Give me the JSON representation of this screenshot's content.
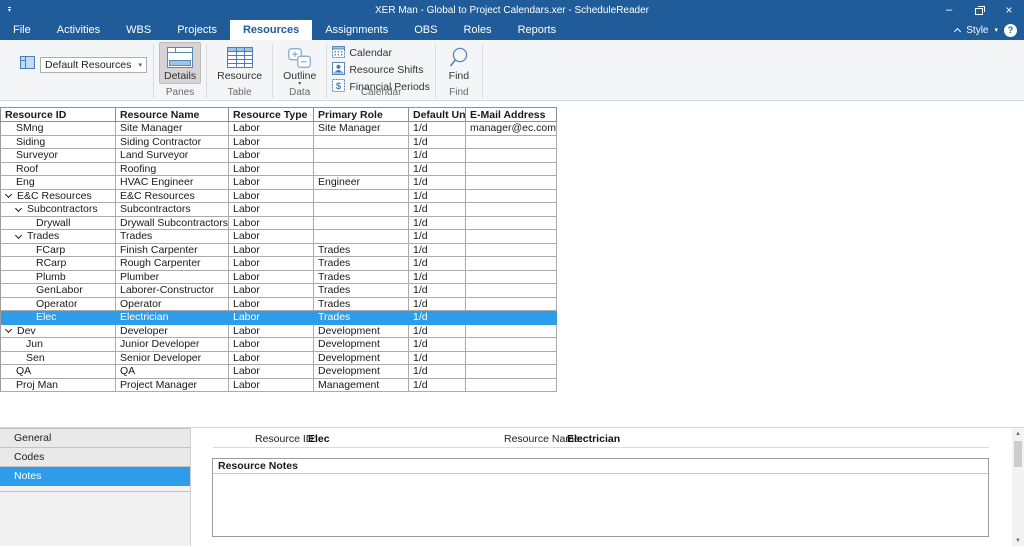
{
  "titlebar": {
    "title": "XER Man - Global to Project Calendars.xer - ScheduleReader",
    "minimize": "–",
    "close": "×"
  },
  "tabs": [
    {
      "label": "File"
    },
    {
      "label": "Activities"
    },
    {
      "label": "WBS"
    },
    {
      "label": "Projects"
    },
    {
      "label": "Resources",
      "active": true
    },
    {
      "label": "Assignments"
    },
    {
      "label": "OBS"
    },
    {
      "label": "Roles"
    },
    {
      "label": "Reports"
    }
  ],
  "tab_extras": {
    "style_label": "Style",
    "help_label": "?"
  },
  "ribbon": {
    "view_selector": {
      "value": "Default Resources"
    },
    "panes_group": {
      "label": "Panes",
      "details_button": "Details"
    },
    "table_group": {
      "label": "Table",
      "resource_button": "Resource"
    },
    "data_group": {
      "label": "Data",
      "outline_button": "Outline"
    },
    "calendar_group": {
      "label": "Calendar",
      "items": [
        {
          "label": "Calendar"
        },
        {
          "label": "Resource Shifts"
        },
        {
          "label": "Financial Periods"
        }
      ]
    },
    "find_group": {
      "label": "Find",
      "find_button": "Find"
    }
  },
  "table": {
    "columns": [
      "Resource ID",
      "Resource Name",
      "Resource Type",
      "Primary Role",
      "Default Units...",
      "E-Mail Address"
    ],
    "rows": [
      {
        "id": "SMng",
        "name": "Site Manager",
        "type": "Labor",
        "role": "Site Manager",
        "units": "1/d",
        "email": "manager@ec.com",
        "level": 0,
        "expandable": false,
        "selected": false
      },
      {
        "id": "Siding",
        "name": "Siding Contractor",
        "type": "Labor",
        "role": "",
        "units": "1/d",
        "email": "",
        "level": 0,
        "expandable": false,
        "selected": false
      },
      {
        "id": "Surveyor",
        "name": "Land Surveyor",
        "type": "Labor",
        "role": "",
        "units": "1/d",
        "email": "",
        "level": 0,
        "expandable": false,
        "selected": false
      },
      {
        "id": "Roof",
        "name": "Roofing",
        "type": "Labor",
        "role": "",
        "units": "1/d",
        "email": "",
        "level": 0,
        "expandable": false,
        "selected": false
      },
      {
        "id": "Eng",
        "name": "HVAC Engineer",
        "type": "Labor",
        "role": "Engineer",
        "units": "1/d",
        "email": "",
        "level": 0,
        "expandable": false,
        "selected": false
      },
      {
        "id": "E&C Resources",
        "name": "E&C Resources",
        "type": "Labor",
        "role": "",
        "units": "1/d",
        "email": "",
        "level": 0,
        "expandable": true,
        "selected": false
      },
      {
        "id": "Subcontractors",
        "name": "Subcontractors",
        "type": "Labor",
        "role": "",
        "units": "1/d",
        "email": "",
        "level": 1,
        "expandable": true,
        "selected": false
      },
      {
        "id": "Drywall",
        "name": "Drywall Subcontractors",
        "type": "Labor",
        "role": "",
        "units": "1/d",
        "email": "",
        "level": 2,
        "expandable": false,
        "selected": false
      },
      {
        "id": "Trades",
        "name": "Trades",
        "type": "Labor",
        "role": "",
        "units": "1/d",
        "email": "",
        "level": 1,
        "expandable": true,
        "selected": false
      },
      {
        "id": "FCarp",
        "name": "Finish Carpenter",
        "type": "Labor",
        "role": "Trades",
        "units": "1/d",
        "email": "",
        "level": 2,
        "expandable": false,
        "selected": false
      },
      {
        "id": "RCarp",
        "name": "Rough Carpenter",
        "type": "Labor",
        "role": "Trades",
        "units": "1/d",
        "email": "",
        "level": 2,
        "expandable": false,
        "selected": false
      },
      {
        "id": "Plumb",
        "name": "Plumber",
        "type": "Labor",
        "role": "Trades",
        "units": "1/d",
        "email": "",
        "level": 2,
        "expandable": false,
        "selected": false
      },
      {
        "id": "GenLabor",
        "name": "Laborer-Constructor",
        "type": "Labor",
        "role": "Trades",
        "units": "1/d",
        "email": "",
        "level": 2,
        "expandable": false,
        "selected": false
      },
      {
        "id": "Operator",
        "name": "Operator",
        "type": "Labor",
        "role": "Trades",
        "units": "1/d",
        "email": "",
        "level": 2,
        "expandable": false,
        "selected": false
      },
      {
        "id": "Elec",
        "name": "Electrician",
        "type": "Labor",
        "role": "Trades",
        "units": "1/d",
        "email": "",
        "level": 2,
        "expandable": false,
        "selected": true
      },
      {
        "id": "Dev",
        "name": "Developer",
        "type": "Labor",
        "role": "Development",
        "units": "1/d",
        "email": "",
        "level": 0,
        "expandable": true,
        "selected": false
      },
      {
        "id": "Jun",
        "name": "Junior Developer",
        "type": "Labor",
        "role": "Development",
        "units": "1/d",
        "email": "",
        "level": 1,
        "expandable": false,
        "selected": false
      },
      {
        "id": "Sen",
        "name": "Senior Developer",
        "type": "Labor",
        "role": "Development",
        "units": "1/d",
        "email": "",
        "level": 1,
        "expandable": false,
        "selected": false
      },
      {
        "id": "QA",
        "name": "QA",
        "type": "Labor",
        "role": "Development",
        "units": "1/d",
        "email": "",
        "level": 0,
        "expandable": false,
        "selected": false
      },
      {
        "id": "Proj Man",
        "name": "Project Manager",
        "type": "Labor",
        "role": "Management",
        "units": "1/d",
        "email": "",
        "level": 0,
        "expandable": false,
        "selected": false
      }
    ]
  },
  "details": {
    "tabs": [
      {
        "label": "General"
      },
      {
        "label": "Codes"
      },
      {
        "label": "Notes",
        "active": true
      }
    ],
    "resource_id_label": "Resource ID:",
    "resource_id_value": "Elec",
    "resource_name_label": "Resource Name:",
    "resource_name_value": "Electrician",
    "notes_title": "Resource Notes"
  },
  "colors": {
    "accent": "#1f5c99",
    "selection": "#2d9ceb",
    "icon_stroke": "#5b87b7",
    "icon_fill": "#9cc5e8"
  }
}
